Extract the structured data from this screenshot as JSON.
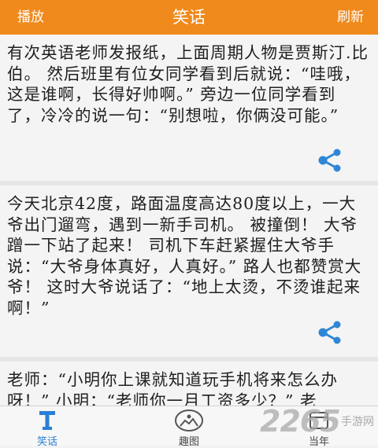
{
  "header": {
    "left_label": "播放",
    "title": "笑话",
    "right_label": "刷新"
  },
  "jokes": [
    {
      "text": "有次英语老师发报纸，上面周期人物是贾斯汀.比伯。 然后班里有位女同学看到后就说：“哇哦，这是谁啊，长得好帅啊。” 旁边一位同学看到了，冷冷的说一句：“别想啦，你俩没可能。”"
    },
    {
      "text": "今天北京42度，路面温度高达80度以上，一大爷出门遛弯，遇到一新手司机。 被撞倒！ 大爷蹭一下站了起来！ 司机下车赶紧握住大爷手说：“大爷身体真好，人真好。” 路人也都赞赏大爷！ 这时大爷说话了：“地上太烫，不烫谁起来啊！”"
    },
    {
      "text": "老师：“小明你上课就知道玩手机将来怎么办呀！” 小明：“老师你一月工资多少？” 老"
    }
  ],
  "tabs": [
    {
      "label": "笑话",
      "icon": "text-t-icon",
      "active": true
    },
    {
      "label": "趣图",
      "icon": "picture-icon",
      "active": false
    },
    {
      "label": "当年",
      "icon": "calendar-icon",
      "active": false
    }
  ],
  "watermark": {
    "number": "2265",
    "site": "手游网"
  },
  "colors": {
    "accent": "#f08a1c",
    "share": "#2f86d6",
    "active_tab": "#2b7fd6"
  }
}
